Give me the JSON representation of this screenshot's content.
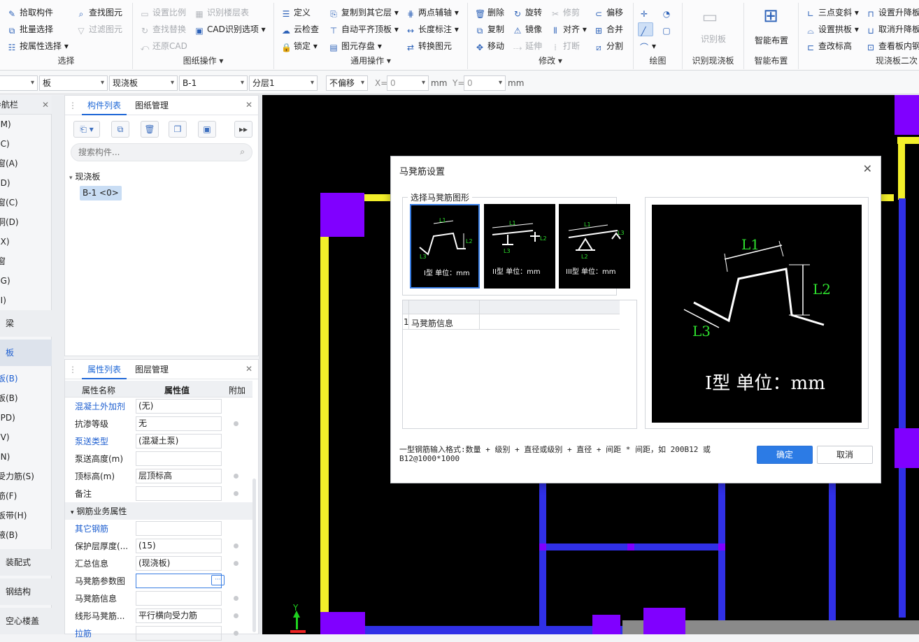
{
  "ribbon": {
    "select": {
      "label": "选择",
      "items": [
        "拾取构件",
        "批量选择",
        "按属性选择"
      ]
    },
    "find": {
      "items": [
        "查找图元",
        "过滤图元"
      ]
    },
    "drawing_ops": {
      "label": "图纸操作",
      "items": [
        "设置比例",
        "识别楼层表",
        "查找替换",
        "CAD识别选项",
        "还原CAD"
      ]
    },
    "general": {
      "label": "通用操作",
      "items": [
        "定义",
        "复制到其它层",
        "两点辅轴",
        "云检查",
        "自动平齐顶板",
        "长度标注",
        "锁定",
        "图元存盘",
        "转换图元"
      ]
    },
    "modify": {
      "label": "修改",
      "items": [
        "删除",
        "旋转",
        "修剪",
        "偏移",
        "复制",
        "镜像",
        "对齐",
        "合并",
        "移动",
        "延伸",
        "打断",
        "分割"
      ]
    },
    "draw": {
      "label": "绘图"
    },
    "recognize": {
      "label": "识别现浇板",
      "item": "识别板"
    },
    "smart": {
      "label": "智能布置",
      "item": "智能布置"
    },
    "secondary": {
      "label": "现浇板二次",
      "items": [
        "三点变斜",
        "设置升降板",
        "设置拱板",
        "取消升降板",
        "查改标高",
        "查看板内钢"
      ]
    }
  },
  "toolbar2": {
    "type": "板",
    "subtype": "现浇板",
    "component": "B-1",
    "layer": "分层1",
    "offset": "不偏移",
    "x_label": "X=",
    "x_value": "0",
    "y_label": "Y=",
    "y_value": "0",
    "unit": "mm"
  },
  "leftnav": {
    "header": "导航栏",
    "items": [
      "(M)",
      "(C)",
      "窗(A)",
      "(D)",
      "窗(C)",
      "洞(D)",
      "(X)",
      "窗",
      "(G)",
      "(I)",
      "梁",
      "板",
      "板(B)",
      "板(B)",
      "(PD)",
      "(V)",
      "(N)",
      "受力筋(S)",
      "筋(F)",
      "板带(H)",
      "腋(B)",
      "装配式",
      "钢结构",
      "空心楼盖"
    ]
  },
  "component_panel": {
    "tabs": [
      "构件列表",
      "图纸管理"
    ],
    "search_placeholder": "搜索构件...",
    "tree_root": "现浇板",
    "tree_item": "B-1 <0>"
  },
  "property_panel": {
    "tabs": [
      "属性列表",
      "图层管理"
    ],
    "columns": [
      "属性名称",
      "属性值",
      "附加"
    ],
    "rows": [
      {
        "name": "混凝土外加剂",
        "value": "(无)"
      },
      {
        "name": "抗渗等级",
        "value": "无"
      },
      {
        "name": "泵送类型",
        "value": "(混凝土泵)"
      },
      {
        "name": "泵送高度(m)",
        "value": ""
      },
      {
        "name": "顶标高(m)",
        "value": "层顶标高"
      },
      {
        "name": "备注",
        "value": ""
      },
      {
        "name": "钢筋业务属性",
        "value": ""
      },
      {
        "name": "其它钢筋",
        "value": ""
      },
      {
        "name": "保护层厚度(...",
        "value": "(15)"
      },
      {
        "name": "汇总信息",
        "value": "(现浇板)"
      },
      {
        "name": "马凳筋参数图",
        "value": ""
      },
      {
        "name": "马凳筋信息",
        "value": ""
      },
      {
        "name": "线形马凳筋...",
        "value": "平行横向受力筋"
      },
      {
        "name": "拉筋",
        "value": ""
      }
    ]
  },
  "canvas": {
    "axis_y": "Y",
    "axis_x": "X"
  },
  "dialog": {
    "title": "马凳筋设置",
    "group_label": "选择马凳筋图形",
    "thumbs": [
      "I型 单位：mm",
      "II型 单位：mm",
      "III型 单位：mm"
    ],
    "table_row_no": "1",
    "table_row_label": "马凳筋信息",
    "preview_caption": "I型 单位：mm",
    "dims": {
      "l1": "L1",
      "l2": "L2",
      "l3": "L3"
    },
    "hint": "一型钢筋输入格式:数量 + 级别 + 直径或级别 + 直径 + 间距 * 间距，如 200B12 或 B12@1000*1000",
    "ok": "确定",
    "cancel": "取消"
  }
}
